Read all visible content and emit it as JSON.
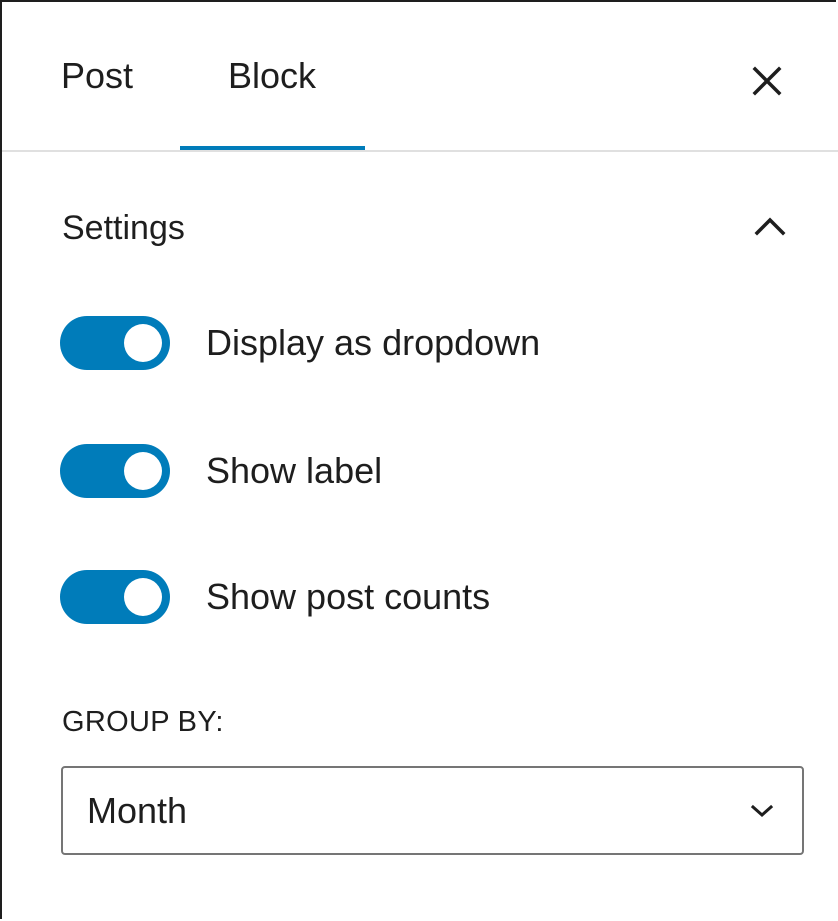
{
  "tabs": {
    "post_label": "Post",
    "block_label": "Block",
    "active": "Block"
  },
  "header": {
    "close_icon": "close-icon"
  },
  "settings": {
    "title": "Settings",
    "collapse_icon": "chevron-up-icon",
    "expanded": true,
    "toggles": [
      {
        "label": "Display as dropdown",
        "checked": true
      },
      {
        "label": "Show label",
        "checked": true
      },
      {
        "label": "Show post counts",
        "checked": true
      }
    ],
    "group_by": {
      "label": "GROUP BY:",
      "selected": "Month",
      "chevron_icon": "chevron-down-icon"
    }
  },
  "colors": {
    "accent": "#007cba",
    "text": "#1e1e1e",
    "divider": "#e0e0e0",
    "field_border": "#757575"
  }
}
